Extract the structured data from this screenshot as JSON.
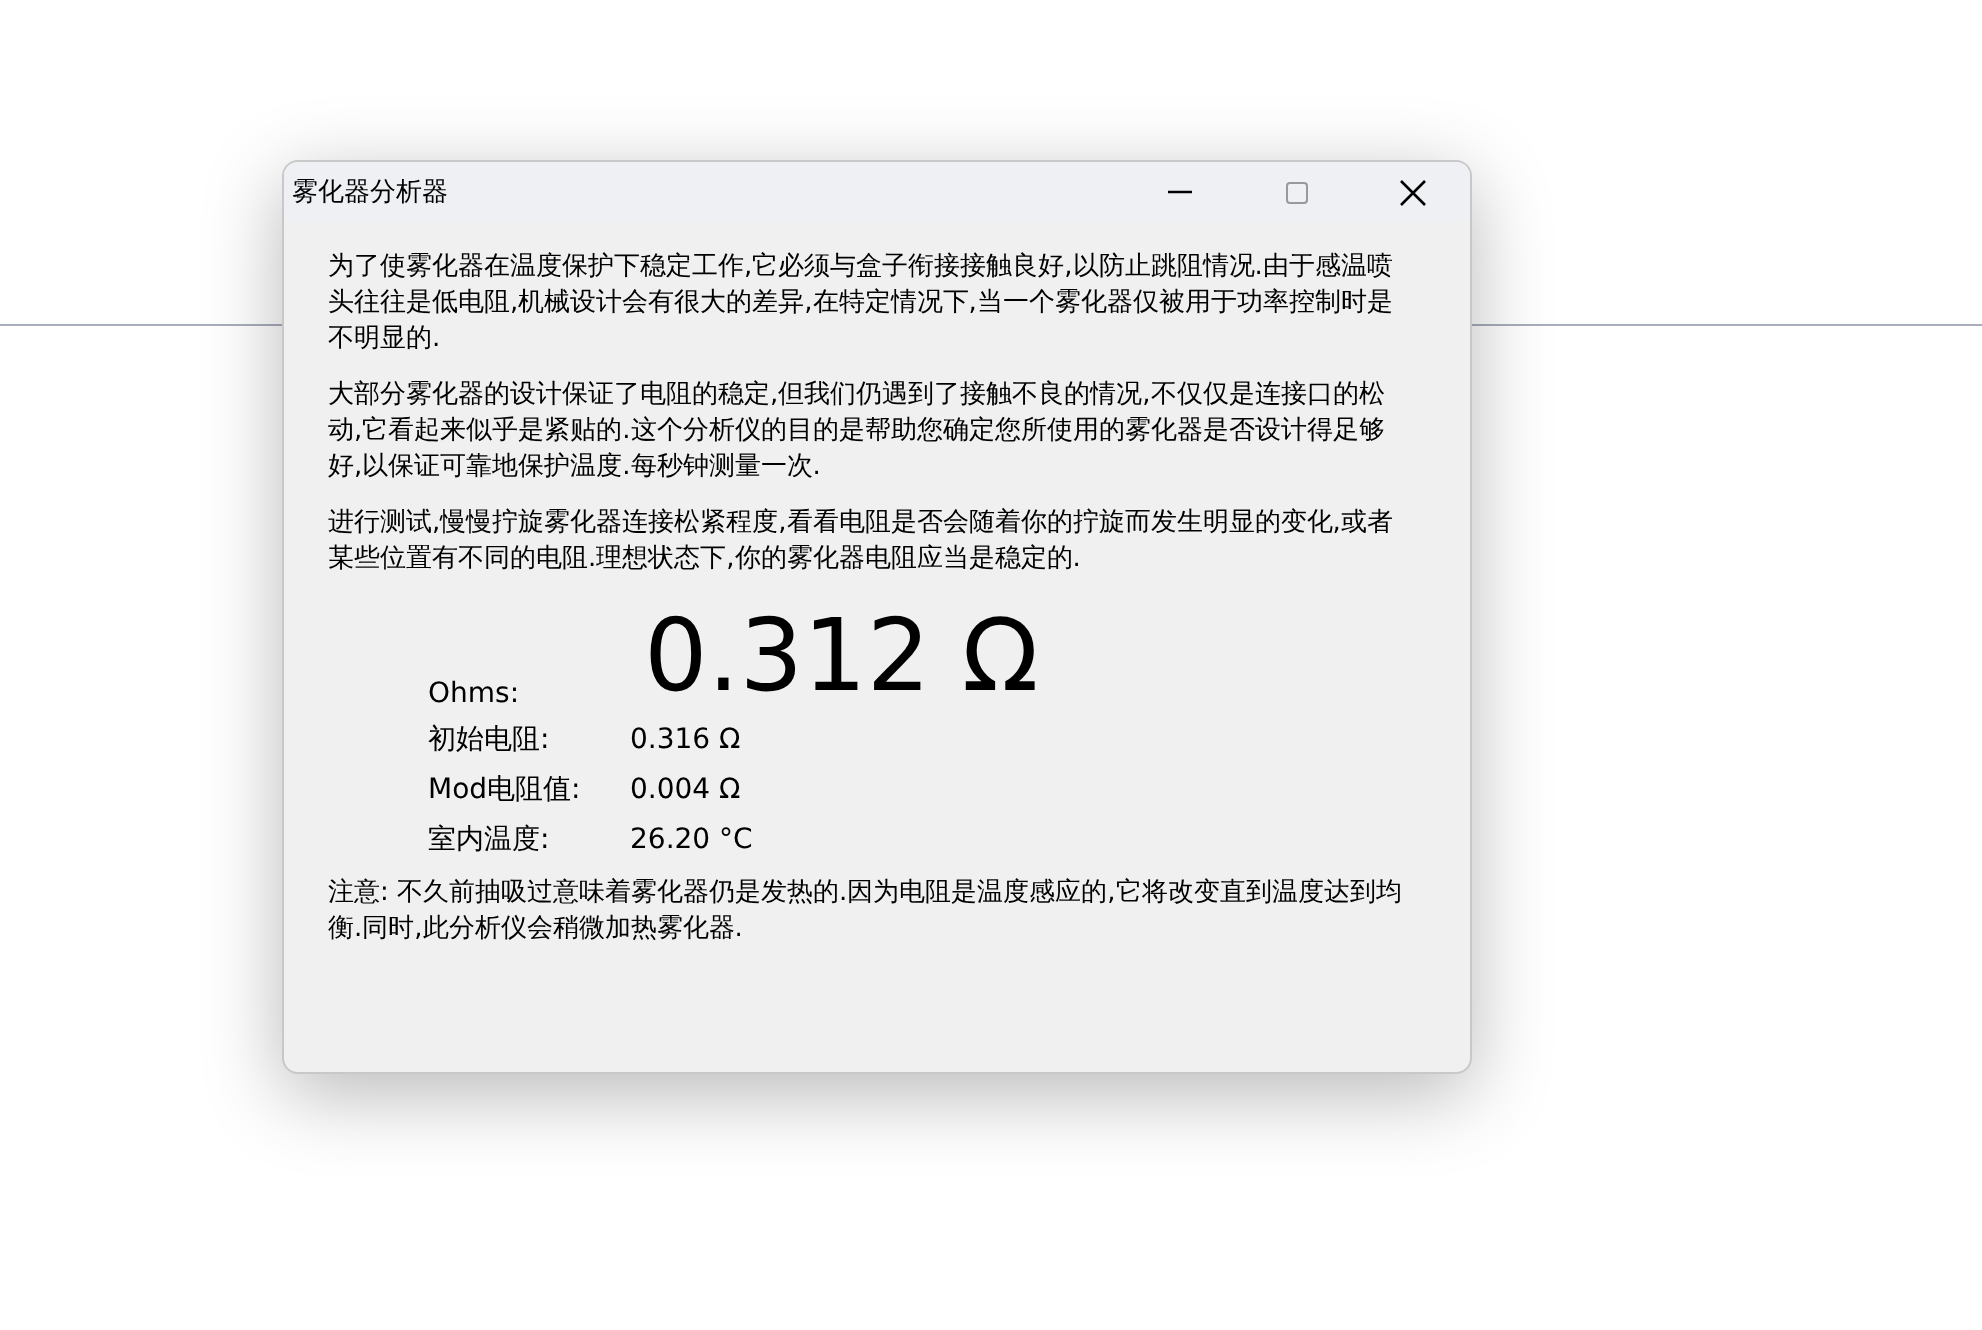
{
  "window": {
    "title": "雾化器分析器"
  },
  "paragraphs": [
    "为了使雾化器在温度保护下稳定工作,它必须与盒子衔接接触良好,以防止跳阻情况.由于感温喷头往往是低电阻,机械设计会有很大的差异,在特定情况下,当一个雾化器仅被用于功率控制时是不明显的.",
    "大部分雾化器的设计保证了电阻的稳定,但我们仍遇到了接触不良的情况,不仅仅是连接口的松动,它看起来似乎是紧贴的.这个分析仪的目的是帮助您确定您所使用的雾化器是否设计得足够好,以保证可靠地保护温度.每秒钟测量一次.",
    "进行测试,慢慢拧旋雾化器连接松紧程度,看看电阻是否会随着你的拧旋而发生明显的变化,或者某些位置有不同的电阻.理想状态下,你的雾化器电阻应当是稳定的."
  ],
  "reading": {
    "label": "Ohms:",
    "value": "0.312 Ω"
  },
  "details": [
    {
      "label": "初始电阻:",
      "value": "0.316 Ω"
    },
    {
      "label": "Mod电阻值:",
      "value": "0.004 Ω"
    },
    {
      "label": "室内温度:",
      "value": "26.20 °C"
    }
  ],
  "note": "注意: 不久前抽吸过意味着雾化器仍是发热的.因为电阻是温度感应的,它将改变直到温度达到均衡.同时,此分析仪会稍微加热雾化器."
}
